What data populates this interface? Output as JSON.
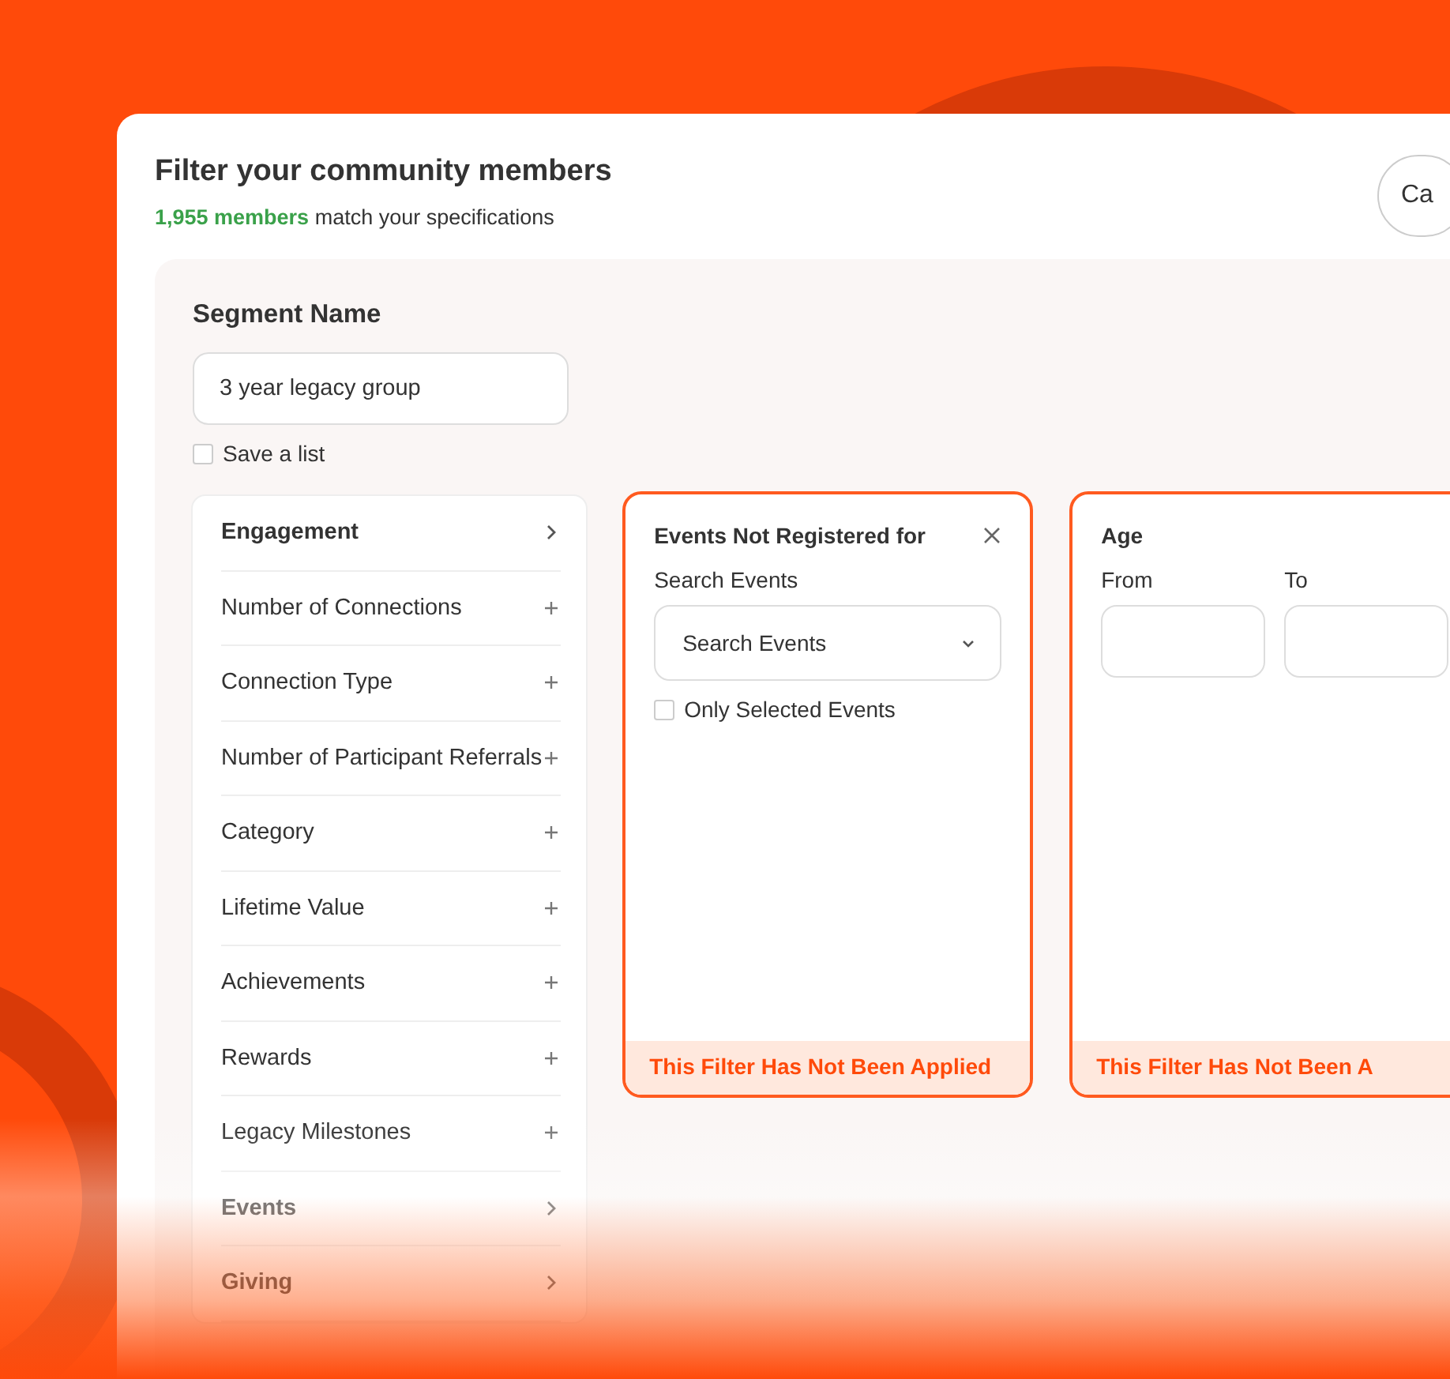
{
  "header": {
    "title": "Filter your community members",
    "count": "1,955 members",
    "count_suffix": "match your specifications",
    "button": "Ca"
  },
  "segment": {
    "label": "Segment Name",
    "value": "3 year legacy group",
    "save_label": "Save a list",
    "save_checked": false
  },
  "sidebar": {
    "items": [
      {
        "kind": "group",
        "label": "Engagement"
      },
      {
        "kind": "filter",
        "label": "Number of Connections"
      },
      {
        "kind": "filter",
        "label": "Connection Type"
      },
      {
        "kind": "filter",
        "label": "Number of Participant Referrals"
      },
      {
        "kind": "filter",
        "label": "Category"
      },
      {
        "kind": "filter",
        "label": "Lifetime Value"
      },
      {
        "kind": "filter",
        "label": "Achievements"
      },
      {
        "kind": "filter",
        "label": "Rewards"
      },
      {
        "kind": "filter",
        "label": "Legacy Milestones"
      },
      {
        "kind": "group",
        "label": "Events"
      },
      {
        "kind": "group",
        "label": "Giving"
      }
    ]
  },
  "filters": [
    {
      "kind": "search",
      "title": "Events Not Registered for",
      "field_label": "Search Events",
      "dropdown": "Search Events",
      "check_label": "Only Selected Events",
      "checked": false,
      "footer": "This Filter Has Not Been Applied"
    },
    {
      "kind": "range",
      "title": "Age",
      "from_label": "From",
      "to_label": "To",
      "footer": "This Filter Has Not Been A"
    }
  ]
}
